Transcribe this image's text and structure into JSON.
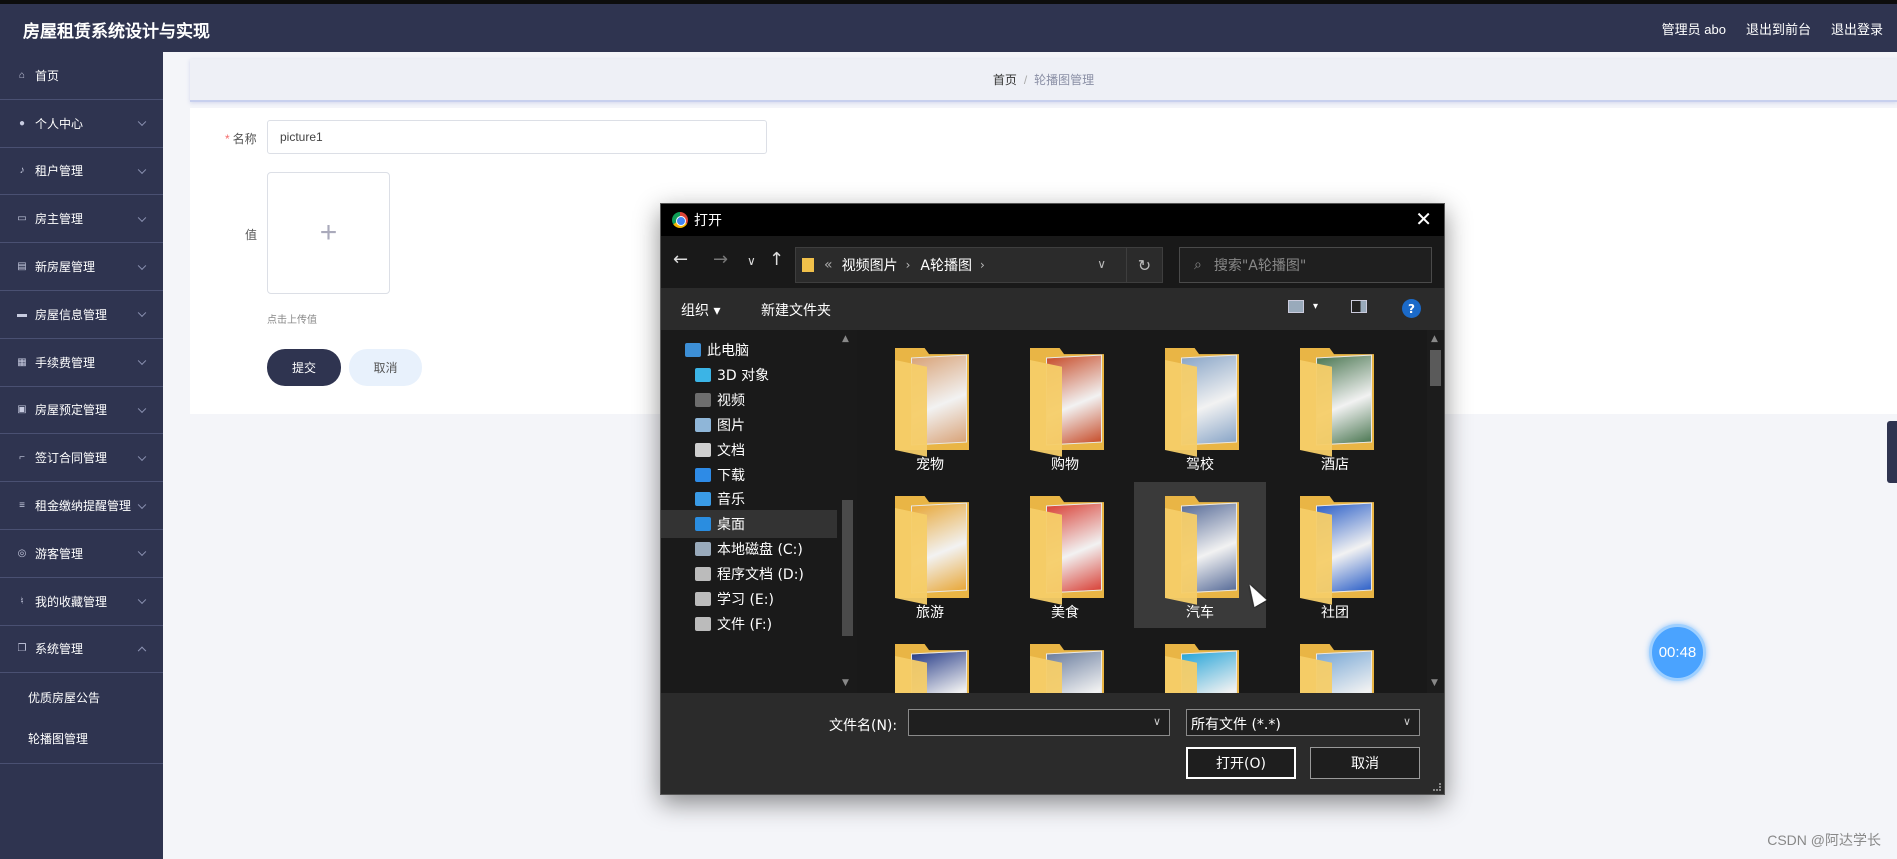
{
  "header": {
    "app_title": "房屋租赁系统设计与实现",
    "admin_label": "管理员 abo",
    "frontend_link": "退出到前台",
    "logout_link": "退出登录"
  },
  "sidebar": {
    "items": [
      {
        "label": "首页",
        "icon": "home-icon",
        "has_sub": false
      },
      {
        "label": "个人中心",
        "icon": "user-icon",
        "has_sub": true
      },
      {
        "label": "租户管理",
        "icon": "bell-icon",
        "has_sub": true
      },
      {
        "label": "房主管理",
        "icon": "chat-icon",
        "has_sub": true
      },
      {
        "label": "新房屋管理",
        "icon": "briefcase-icon",
        "has_sub": true
      },
      {
        "label": "房屋信息管理",
        "icon": "database-icon",
        "has_sub": true
      },
      {
        "label": "手续费管理",
        "icon": "grid-icon",
        "has_sub": true
      },
      {
        "label": "房屋预定管理",
        "icon": "clipboard-icon",
        "has_sub": true
      },
      {
        "label": "签订合同管理",
        "icon": "crop-icon",
        "has_sub": true
      },
      {
        "label": "租金缴纳提醒管理",
        "icon": "list-icon",
        "has_sub": true
      },
      {
        "label": "游客管理",
        "icon": "globe-icon",
        "has_sub": true
      },
      {
        "label": "我的收藏管理",
        "icon": "mic-icon",
        "has_sub": true
      },
      {
        "label": "系统管理",
        "icon": "copy-icon",
        "has_sub": true,
        "expanded": true
      }
    ],
    "sub_items": [
      "优质房屋公告",
      "轮播图管理"
    ]
  },
  "breadcrumb": {
    "home": "首页",
    "separator": "/",
    "current": "轮播图管理"
  },
  "form": {
    "name_label": "名称",
    "name_value": "picture1",
    "value_label": "值",
    "upload_hint": "点击上传值",
    "submit_label": "提交",
    "cancel_label": "取消"
  },
  "timer": "00:48",
  "watermark": "CSDN @阿达学长",
  "dialog": {
    "title": "打开",
    "path": [
      "视频图片",
      "A轮播图"
    ],
    "search_placeholder": "搜索\"A轮播图\"",
    "organize": "组织",
    "new_folder": "新建文件夹",
    "help": "?",
    "nav": [
      {
        "label": "此电脑",
        "icon": "computer-icon",
        "color": "#3d8fd6",
        "indent": 0
      },
      {
        "label": "3D 对象",
        "icon": "3d-objects-icon",
        "color": "#3bb4e6",
        "indent": 1
      },
      {
        "label": "视频",
        "icon": "video-icon",
        "color": "#6d6d6d",
        "indent": 1
      },
      {
        "label": "图片",
        "icon": "pictures-icon",
        "color": "#8fb6d8",
        "indent": 1
      },
      {
        "label": "文档",
        "icon": "documents-icon",
        "color": "#cfcfcf",
        "indent": 1
      },
      {
        "label": "下载",
        "icon": "download-icon",
        "color": "#2e8be6",
        "indent": 1
      },
      {
        "label": "音乐",
        "icon": "music-icon",
        "color": "#3a9be6",
        "indent": 1
      },
      {
        "label": "桌面",
        "icon": "desktop-icon",
        "color": "#2a8de0",
        "indent": 1,
        "selected": true
      },
      {
        "label": "本地磁盘 (C:)",
        "icon": "drive-c-icon",
        "color": "#9ab",
        "indent": 1
      },
      {
        "label": "程序文档 (D:)",
        "icon": "drive-d-icon",
        "color": "#bbb",
        "indent": 1
      },
      {
        "label": "学习 (E:)",
        "icon": "drive-e-icon",
        "color": "#bbb",
        "indent": 1
      },
      {
        "label": "文件 (F:)",
        "icon": "drive-f-icon",
        "color": "#bbb",
        "indent": 1
      }
    ],
    "folders": [
      {
        "name": "宠物",
        "thumb": "#d9a47a"
      },
      {
        "name": "购物",
        "thumb": "#c8502e"
      },
      {
        "name": "驾校",
        "thumb": "#8aa6c8"
      },
      {
        "name": "酒店",
        "thumb": "#4f7a56"
      },
      {
        "name": "旅游",
        "thumb": "#e8a83a"
      },
      {
        "name": "美食",
        "thumb": "#d9443a"
      },
      {
        "name": "汽车",
        "thumb": "#5a6e9a",
        "selected": true
      },
      {
        "name": "社团",
        "thumb": "#2f62c9"
      },
      {
        "name": "",
        "thumb": "#2a3f8a"
      },
      {
        "name": "",
        "thumb": "#6c7fa0"
      },
      {
        "name": "",
        "thumb": "#2aa6d9"
      },
      {
        "name": "",
        "thumb": "#79a8d6"
      }
    ],
    "filename_label": "文件名(N):",
    "filename_value": "",
    "filter_value": "所有文件 (*.*)",
    "open_label": "打开(O)",
    "cancel_label": "取消"
  }
}
